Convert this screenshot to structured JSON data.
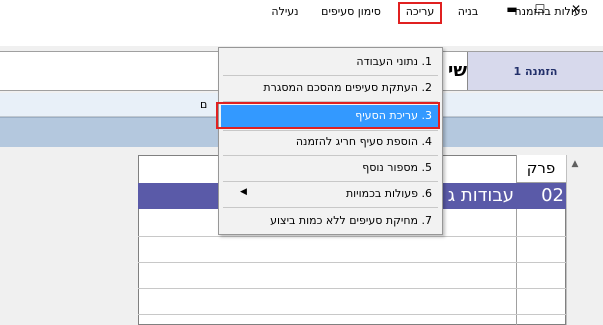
{
  "window": {
    "minimize_label": "▬",
    "maximize_label": "☐",
    "close_label": "✕"
  },
  "menubar": {
    "items": [
      {
        "label": "פעולות בהזמנה"
      },
      {
        "label": "בניה"
      },
      {
        "label": "עריכה"
      },
      {
        "label": "סימון סעיפים"
      },
      {
        "label": "נעילה"
      }
    ]
  },
  "header": {
    "title_fragment": "שי",
    "order_tab": "הזמנה 1"
  },
  "info": {
    "text": "ם"
  },
  "grid": {
    "columns": [
      {
        "label": "פרק"
      }
    ],
    "selected_row": {
      "code": "02",
      "description": "עבודות ג"
    }
  },
  "dropdown": {
    "items": [
      {
        "label": "1. נתוני העבודה"
      },
      {
        "label": "2. העתקת סעיפים מהסכם המסגרת"
      },
      {
        "label": "3. עריכת הסעיף"
      },
      {
        "label": "4. הוספת סעיף חריג להזמנה"
      },
      {
        "label": "5. מספור נוסף"
      },
      {
        "label": "6. פעולות בכמויות"
      },
      {
        "label": "7. מחיקת סעיפים ללא כמות ביצוע"
      }
    ],
    "submenu_arrow": "◀"
  },
  "colors": {
    "selection": "#3399ff",
    "selected_row": "#5a5aa8",
    "highlight_box": "#e02020",
    "order_tab": "#d7d9ec"
  }
}
